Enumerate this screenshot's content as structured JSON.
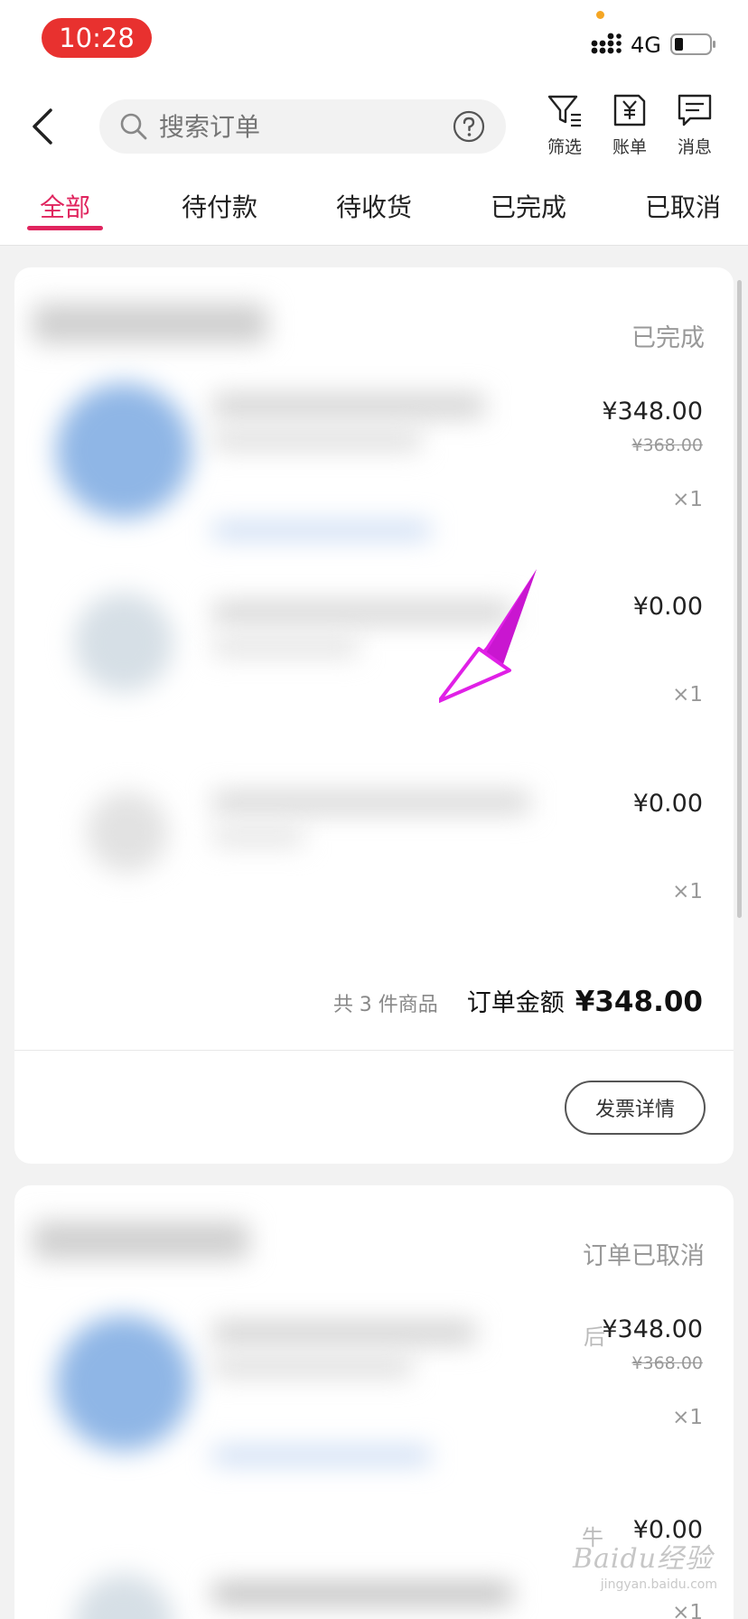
{
  "status_bar": {
    "time": "10:28",
    "network": "4G"
  },
  "header": {
    "search_placeholder": "搜索订单",
    "tools": [
      {
        "label": "筛选",
        "icon": "filter-icon"
      },
      {
        "label": "账单",
        "icon": "bill-icon"
      },
      {
        "label": "消息",
        "icon": "message-icon"
      }
    ]
  },
  "tabs": [
    {
      "label": "全部",
      "active": true
    },
    {
      "label": "待付款",
      "active": false
    },
    {
      "label": "待收货",
      "active": false
    },
    {
      "label": "已完成",
      "active": false
    },
    {
      "label": "已取消",
      "active": false
    }
  ],
  "orders": [
    {
      "status": "已完成",
      "items": [
        {
          "price": "¥348.00",
          "original_price": "¥368.00",
          "quantity": "×1"
        },
        {
          "price": "¥0.00",
          "quantity": "×1"
        },
        {
          "price": "¥0.00",
          "quantity": "×1"
        }
      ],
      "summary": {
        "count_text": "共 3 件商品",
        "amount_label": "订单金额",
        "amount": "¥348.00"
      },
      "action_button": "发票详情"
    },
    {
      "status": "订单已取消",
      "items": [
        {
          "price": "¥348.00",
          "original_price": "¥368.00",
          "quantity": "×1",
          "partial_prefix": "后"
        },
        {
          "price": "¥0.00",
          "quantity": "×1",
          "partial_prefix": "牛"
        }
      ]
    }
  ],
  "watermark": {
    "main": "Baidu经验",
    "sub": "jingyan.baidu.com"
  },
  "colors": {
    "accent": "#e0245e",
    "time_pill": "#e8312f",
    "arrow": "#e020e6"
  }
}
